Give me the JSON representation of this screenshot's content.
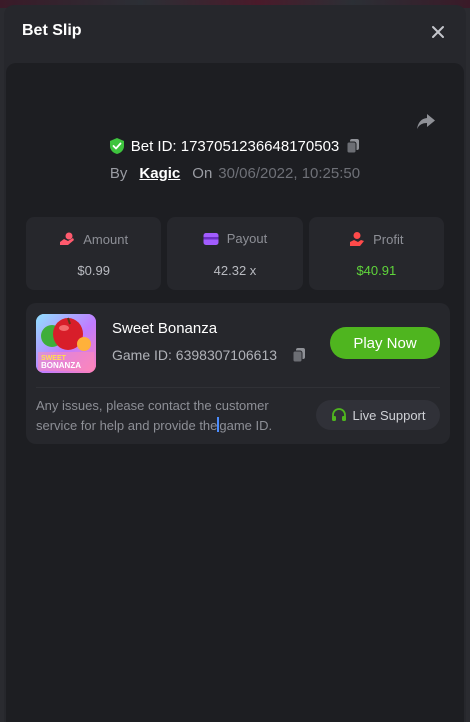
{
  "modal": {
    "title": "Bet Slip"
  },
  "bet": {
    "id_label": "Bet ID: 1737051236648170503",
    "by_label": "By",
    "username": "Kagic",
    "on_label": "On",
    "datetime": "30/06/2022, 10:25:50"
  },
  "stats": [
    {
      "label": "Amount",
      "value": "$0.99",
      "icon": "coin-hand-icon",
      "color": "#ff5a6e"
    },
    {
      "label": "Payout",
      "value": "42.32 x",
      "icon": "wallet-icon",
      "color": "#a25cff"
    },
    {
      "label": "Profit",
      "value": "$40.91",
      "icon": "profit-hand-icon",
      "color": "#ff4a4a"
    }
  ],
  "game": {
    "name": "Sweet Bonanza",
    "id_label": "Game ID: 6398307106613",
    "thumb_text": "SWEET BONANZA",
    "play_label": "Play Now"
  },
  "support": {
    "message_a": "Any issues, please contact the customer service for help and provide the",
    "message_b": "game ID.",
    "button_label": "Live Support"
  },
  "colors": {
    "accent_green": "#4fb51f",
    "profit_green": "#5fd43b",
    "verified_green": "#3ec43e",
    "panel_bg": "#1d1e22",
    "card_bg": "#26272c"
  }
}
